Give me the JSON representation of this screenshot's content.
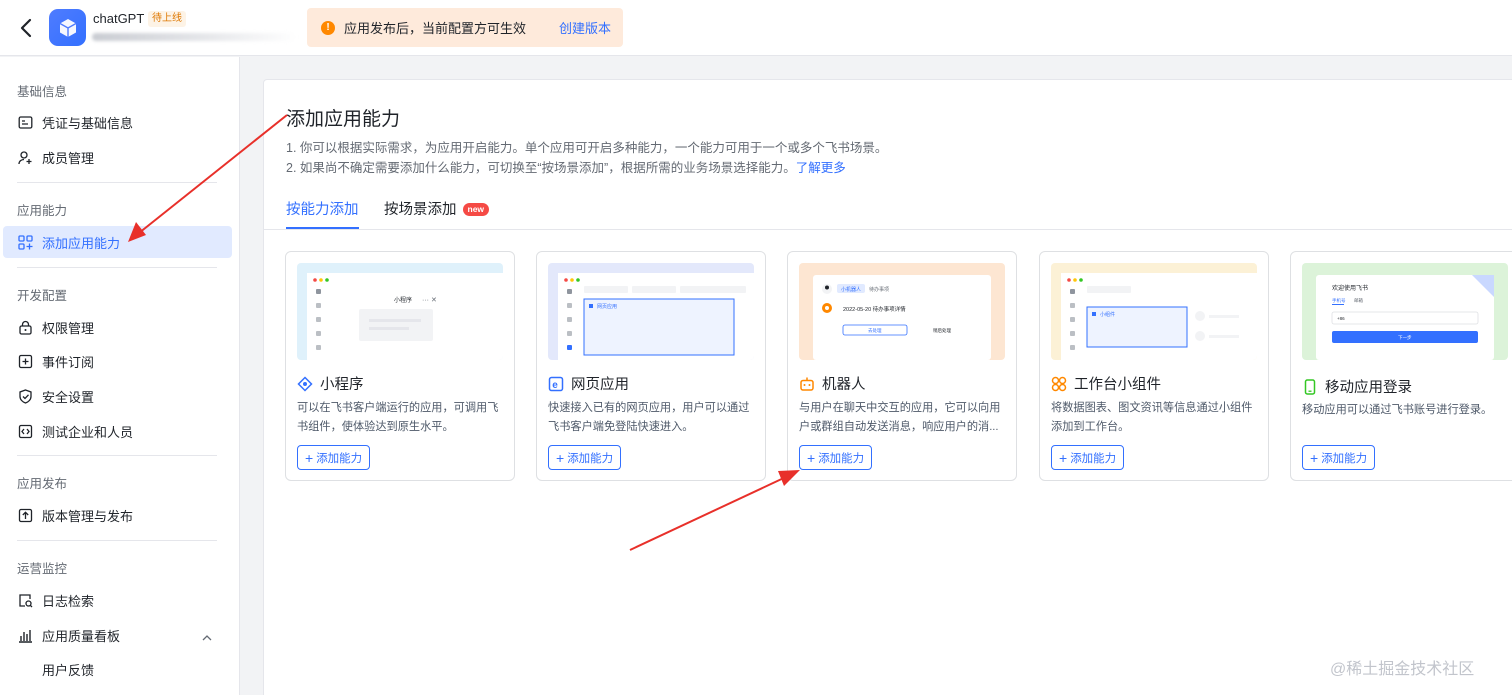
{
  "topbar": {
    "app_name": "chatGPT",
    "app_status": "待上线",
    "notice_text": "应用发布后，当前配置方可生效",
    "notice_link": "创建版本"
  },
  "sidebar": {
    "groups": [
      {
        "title": "基础信息",
        "items": [
          {
            "label": "凭证与基础信息",
            "icon": "id-card-icon"
          },
          {
            "label": "成员管理",
            "icon": "user-add-icon"
          }
        ]
      },
      {
        "title": "应用能力",
        "items": [
          {
            "label": "添加应用能力",
            "icon": "grid-add-icon",
            "active": true
          }
        ]
      },
      {
        "title": "开发配置",
        "items": [
          {
            "label": "权限管理",
            "icon": "lock-icon"
          },
          {
            "label": "事件订阅",
            "icon": "event-icon"
          },
          {
            "label": "安全设置",
            "icon": "shield-icon"
          },
          {
            "label": "测试企业和人员",
            "icon": "code-icon"
          }
        ]
      },
      {
        "title": "应用发布",
        "items": [
          {
            "label": "版本管理与发布",
            "icon": "upload-icon"
          }
        ]
      },
      {
        "title": "运营监控",
        "items": [
          {
            "label": "日志检索",
            "icon": "log-search-icon"
          },
          {
            "label": "应用质量看板",
            "icon": "bar-chart-icon",
            "expanded": true
          },
          {
            "label": "用户反馈",
            "icon": ""
          }
        ]
      }
    ]
  },
  "main": {
    "title": "添加应用能力",
    "desc_line1": "1. 你可以根据实际需求，为应用开启能力。单个应用可开启多种能力，一个能力可用于一个或多个飞书场景。",
    "desc_line2": "2. 如果尚不确定需要添加什么能力，可切换至“按场景添加”，根据所需的业务场景选择能力。",
    "desc_link": "了解更多",
    "tabs": [
      {
        "label": "按能力添加",
        "active": true
      },
      {
        "label": "按场景添加",
        "badge": "new"
      }
    ],
    "add_label": "添加能力",
    "cards": [
      {
        "title": "小程序",
        "icon": "mini-program-icon",
        "desc": "可以在飞书客户端运行的应用，可调用飞书组件，使体验达到原生水平。",
        "preview_label": "小程序"
      },
      {
        "title": "网页应用",
        "icon": "web-app-icon",
        "desc": "快速接入已有的网页应用，用户可以通过飞书客户端免登陆快速进入。",
        "preview_label": "网页应用"
      },
      {
        "title": "机器人",
        "icon": "robot-icon",
        "desc": "与用户在聊天中交互的应用，它可以向用户或群组自动发送消息，响应用户的消...",
        "preview_chip": "小机器人",
        "preview_chip2": "待办事项",
        "preview_date": "2022-05-20 待办事项详情",
        "preview_btn": "去处理",
        "preview_btn2": "稍后处理"
      },
      {
        "title": "工作台小组件",
        "icon": "widget-icon",
        "desc": "将数据图表、图文资讯等信息通过小组件添加到工作台。",
        "preview_label": "小组件"
      },
      {
        "title": "移动应用登录",
        "icon": "mobile-icon",
        "desc": "移动应用可以通过飞书账号进行登录。",
        "preview_title": "欢迎使用飞书",
        "preview_tab1": "手机号",
        "preview_tab2": "邮箱",
        "preview_code": "+86",
        "preview_btn": "下一步"
      }
    ]
  },
  "watermark": "@稀土掘金技术社区",
  "colors": {
    "accent": "#3370ff",
    "annotation_arrow": "#e8302a",
    "notice_bg": "#feeadb"
  }
}
